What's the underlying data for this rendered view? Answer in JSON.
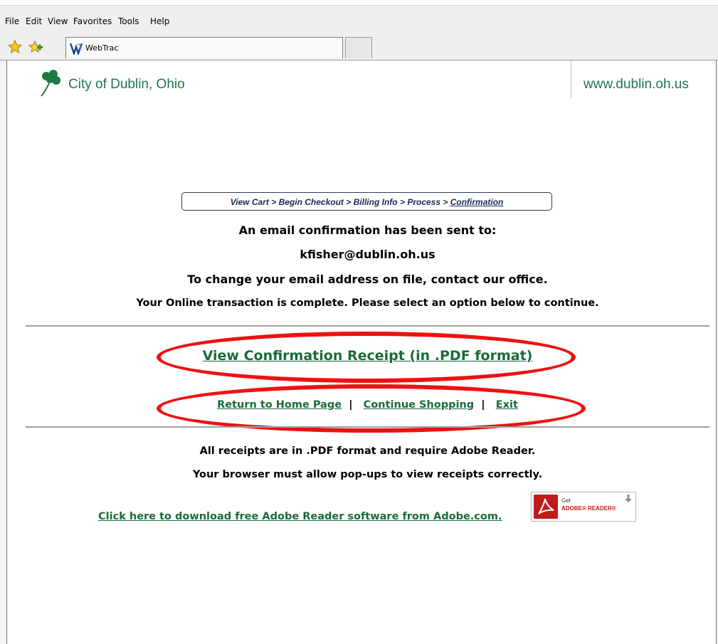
{
  "menu": [
    "File",
    "Edit",
    "View",
    "Favorites",
    "Tools",
    "Help"
  ],
  "tabs": {
    "active_title": "WebTrac"
  },
  "header": {
    "org_name": "City of Dublin, Ohio",
    "site_url": "www.dublin.oh.us"
  },
  "checkout_steps": [
    "View Cart",
    "Begin Checkout",
    "Billing Info",
    "Process",
    "Confirmation"
  ],
  "checkout_separator": ">",
  "messages": {
    "email_sent": "An email confirmation has been sent to:",
    "email_address": "kfisher@dublin.oh.us",
    "change_email": "To change your email address on file, contact our office.",
    "complete": "Your Online transaction is complete. Please select an option below to continue."
  },
  "links": {
    "receipt": "View Confirmation Receipt (in .PDF format)",
    "home": "Return to Home Page",
    "shopping": "Continue Shopping",
    "exit": "Exit",
    "separator": "|"
  },
  "footer": {
    "receipts_pdf": "All receipts are in .PDF format and require Adobe Reader.",
    "popups": "Your browser must allow pop-ups to view receipts correctly.",
    "download_link": "Click here to download free Adobe Reader software from Adobe.com."
  },
  "adobe_badge": {
    "get": "Get",
    "brand": "ADOBE® READER®"
  },
  "colors": {
    "link_green": "#1b6b3a",
    "brand_green": "#20774a",
    "highlight_red": "#ee1111",
    "crumb_navy": "#1b2a55"
  }
}
